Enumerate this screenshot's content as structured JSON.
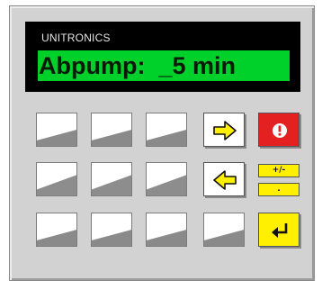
{
  "device": {
    "brand": "UNITRONICS",
    "display_text": "Abpump:  _5 min"
  },
  "keys": {
    "right_arrow": "right-arrow-icon",
    "left_arrow": "left-arrow-icon",
    "alarm": "alarm-icon",
    "plus_minus_label": "+/-",
    "decimal_label": ".",
    "enter": "enter-icon"
  },
  "colors": {
    "lcd_background": "#00d02a",
    "alarm_key": "#e52020",
    "function_keys": "#ffef00"
  }
}
